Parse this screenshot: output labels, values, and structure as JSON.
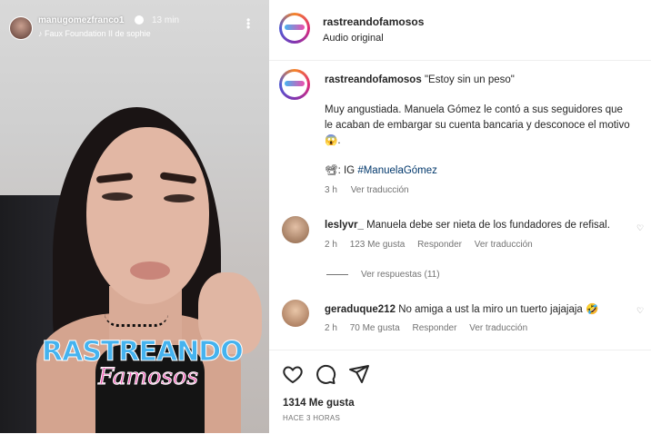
{
  "story": {
    "username": "manugomezfranco1",
    "time": "13 min",
    "audio": "Faux Foundation II de sophie",
    "watermark_line1": "RASTREANDO",
    "watermark_line2": "Famosos"
  },
  "post": {
    "header_user": "rastreandofamosos",
    "header_sub": "Audio original",
    "caption_user": "rastreandofamosos",
    "caption_title": "\"Estoy sin un peso\"",
    "caption_body": "Muy angustiada. Manuela Gómez le contó a sus seguidores que\nle acaban de embargar su cuenta bancaria y desconoce el motivo\n😱.",
    "caption_source_prefix": "📽: IG ",
    "caption_hashtag": "#ManuelaGómez",
    "caption_time": "3 h",
    "caption_translate": "Ver traducción"
  },
  "comments": [
    {
      "user": "leslyvr_",
      "text": "Manuela debe ser nieta de los fundadores de refisal.",
      "time": "2 h",
      "likes": "123 Me gusta",
      "reply": "Responder",
      "translate": "Ver traducción",
      "view_replies": "Ver respuestas (11)"
    },
    {
      "user": "geraduque212",
      "text": "No amiga a ust la miro un tuerto jajajaja 🤣",
      "time": "2 h",
      "likes": "70 Me gusta",
      "reply": "Responder",
      "translate": "Ver traducción"
    }
  ],
  "footer": {
    "likes": "1314 Me gusta",
    "when": "HACE 3 HORAS"
  },
  "icons": [
    "heart-icon",
    "comment-icon",
    "share-icon",
    "more-icon",
    "verified-icon"
  ],
  "colors": {
    "text": "#262626",
    "muted": "#737373",
    "hashtag": "#00376b",
    "brand_blue": "#45b3ef",
    "brand_pink": "#ec4fae"
  }
}
